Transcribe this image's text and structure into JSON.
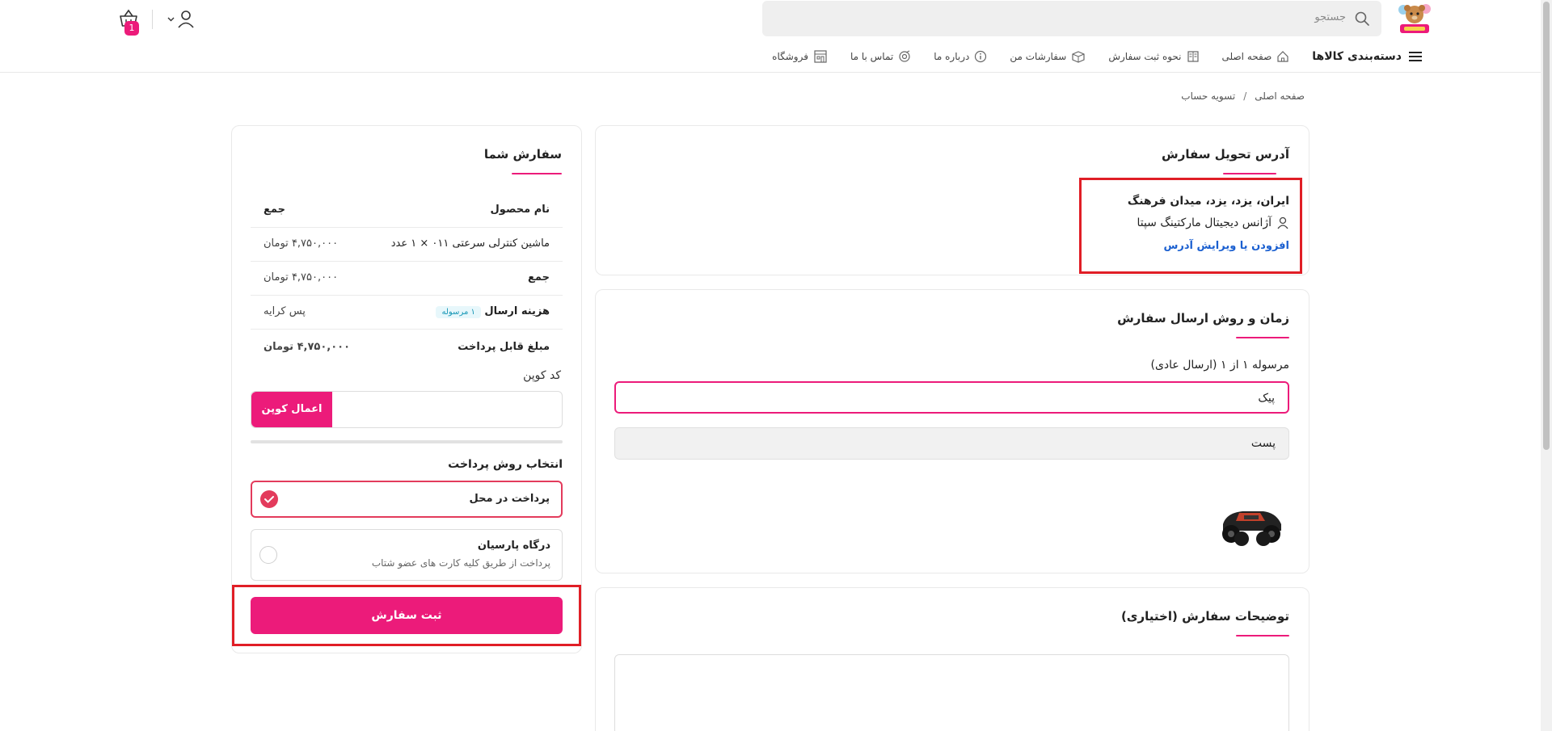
{
  "header": {
    "search_placeholder": "جستجو",
    "cart_count": "1",
    "accent_color": "#ec1b7a"
  },
  "nav": {
    "items": [
      {
        "label": "دسته‌بندی کالاها",
        "icon": "menu-icon"
      },
      {
        "label": "صفحه اصلی",
        "icon": "home-icon"
      },
      {
        "label": "نحوه ثبت سفارش",
        "icon": "book-icon"
      },
      {
        "label": "سفارشات من",
        "icon": "box-icon"
      },
      {
        "label": "درباره ما",
        "icon": "info-icon"
      },
      {
        "label": "تماس با ما",
        "icon": "phone-icon"
      },
      {
        "label": "فروشگاه",
        "icon": "store-icon"
      }
    ]
  },
  "breadcrumb": {
    "home": "صفحه اصلی",
    "separator": "/",
    "current": "تسویه حساب"
  },
  "address": {
    "title": "آدرس تحویل سفارش",
    "line": "ایران، یزد، یزد، میدان فرهنگ",
    "recipient": "آژانس دیجیتال مارکتینگ سپتا",
    "edit_link": "افزودن یا ویرایش آدرس"
  },
  "shipping": {
    "title": "زمان و روش ارسال سفارش",
    "package_label": "مرسوله ۱ از ۱ (ارسال عادی)",
    "options": [
      "پیک",
      "پست"
    ]
  },
  "notes": {
    "title": "توضیحات سفارش (اختیاری)"
  },
  "order": {
    "title": "سفارش شما",
    "head_product": "نام محصول",
    "head_total": "جمع",
    "product_name": "ماشین کنترلی سرعتی ۰۱۱ × ۱ عدد",
    "product_price": "۴,۷۵۰,۰۰۰ تومان",
    "subtotal_label": "جمع",
    "subtotal_value": "۴,۷۵۰,۰۰۰ تومان",
    "shipping_label": "هزینه ارسال",
    "shipping_pill": "۱ مرسوله",
    "shipping_value": "پس کرایه",
    "payable_label": "مبلغ قابل پرداخت",
    "payable_value": "۴,۷۵۰,۰۰۰ تومان",
    "coupon_label": "کد کوپن",
    "coupon_button": "اعمال کوپن",
    "payment_title": "انتخاب روش پرداخت",
    "payment_cod": "پرداخت در محل",
    "payment_gateway": "درگاه پارسیان",
    "payment_gateway_desc": "پرداخت از طریق کلیه کارت های عضو شتاب",
    "submit": "ثبت سفارش"
  }
}
